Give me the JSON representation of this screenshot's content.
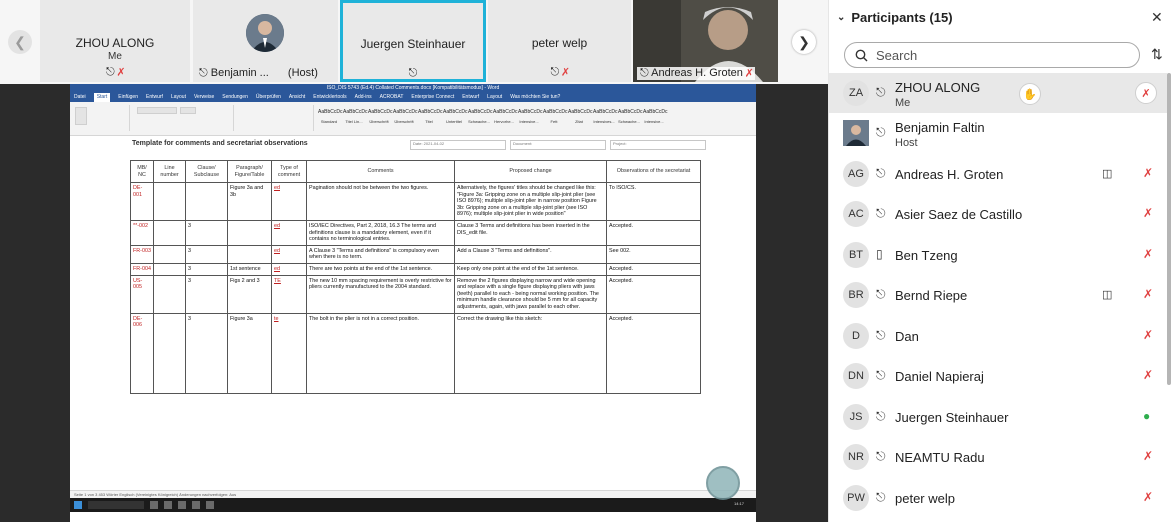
{
  "filmstrip": {
    "tiles": [
      {
        "name": "ZHOU ALONG",
        "sub": "Me"
      },
      {
        "name": "Benjamin ...",
        "sub": "(Host)"
      },
      {
        "name": "Juergen Steinhauer",
        "sub": ""
      },
      {
        "name": "peter welp",
        "sub": ""
      },
      {
        "name": "Andreas H. Groten",
        "sub": ""
      }
    ]
  },
  "word": {
    "title_bar": "ISO_DIS 5743 (Ed.4) Collated Comments.docx [Kompatibilitätsmodus] - Word",
    "tabs": [
      "Datei",
      "Start",
      "Einfügen",
      "Entwurf",
      "Layout",
      "Verweise",
      "Sendungen",
      "Überprüfen",
      "Ansicht",
      "Entwicklertools",
      "Add-ins",
      "ACROBAT",
      "Enterprise Connect",
      "Entwurf",
      "Layout",
      "Was möchten Sie tun?"
    ],
    "styles": [
      "Standard",
      "Titel Lin...",
      "Überschrift",
      "Überschrift",
      "Titel",
      "Untertitel",
      "Schwache...",
      "Hervorhe...",
      "Intensive...",
      "Fett",
      "Zitat",
      "Intensives...",
      "Schwache...",
      "Intensive..."
    ],
    "doc_heading": "Template for comments and secretariat observations",
    "doc_meta": [
      "Date: 2021-04-02",
      "Document:",
      "Project:"
    ],
    "table_headers": [
      "MB/ NC",
      "Line number",
      "Clause/ Subclause",
      "Paragraph/ Figure/Table",
      "Type of comment",
      "Comments",
      "Proposed change",
      "Observations of the secretariat"
    ],
    "rows": [
      {
        "mb": "DE-001",
        "line": "",
        "clause": "",
        "para": "Figure 3a and 3b",
        "type": "ed",
        "comment": "Pagination should not be between the two figures.",
        "change": "Alternatively, the figures' titles should be changed like this: \"Figure 3a: Gripping zone on a multiple slip-joint plier (see ISO 8976); multiple slip-joint plier in narrow position Figure 3b: Gripping zone on a multiple slip-joint plier (see ISO 8976); multiple slip-joint plier in wide position\"",
        "obs": "To ISO/CS."
      },
      {
        "mb": "**-002",
        "line": "",
        "clause": "3",
        "para": "",
        "type": "ed",
        "comment": "ISO/IEC Directives, Part 2, 2018, 16.3 The terms and definitions clause is a mandatory element, even if it contains no terminological entries.",
        "change": "Clause 3 Terms and definitions has been inserted in the DIS_edit file.",
        "obs": "Accepted."
      },
      {
        "mb": "FR-003",
        "line": "",
        "clause": "3",
        "para": "",
        "type": "ed",
        "comment": "A Clause 3 \"Terms and definitions\" is compulsory even when there is no term.",
        "change": "Add a Clause 3 \"Terms and definitions\".",
        "obs": "See 002."
      },
      {
        "mb": "FR-004",
        "line": "",
        "clause": "3",
        "para": "1st sentence",
        "type": "ed",
        "comment": "There are two points at the end of the 1st sentence.",
        "change": "Keep only one point at the end of the 1st sentence.",
        "obs": "Accepted."
      },
      {
        "mb": "US-005",
        "line": "",
        "clause": "3",
        "para": "Figs 2 and 3",
        "type": "TE",
        "comment": "The new 10 mm spacing requirement is overly restrictive for pliers currently manufactured to the 2004 standard.",
        "change": "Remove the 2 figures displaying narrow and wide opening and replace with a single figure displaying pliers with jaws (teeth) parallel to each - being normal working position. The minimum handle clearance should be 5 mm for all capacity adjustments, again, with jaws parallel to each other.",
        "obs": "Accepted."
      },
      {
        "mb": "DE-006",
        "line": "",
        "clause": "3",
        "para": "Figure 3a",
        "type": "te",
        "comment": "The bolt in the plier is not in a correct position.",
        "change": "Correct the drawing like this sketch:",
        "obs": "Accepted."
      }
    ],
    "status_bar": "Seite 1 von 3   453 Wörter   Englisch (Vereinigtes Königreich)   Änderungen nachverfolgen: Aus",
    "clock": "14:17"
  },
  "participants": {
    "title": "Participants (15)",
    "search_placeholder": "Search",
    "list": [
      {
        "initials": "ZA",
        "name": "ZHOU ALONG",
        "role": "Me"
      },
      {
        "initials": "",
        "name": "Benjamin Faltin",
        "role": "Host"
      },
      {
        "initials": "AG",
        "name": "Andreas H. Groten",
        "role": ""
      },
      {
        "initials": "AC",
        "name": "Asier Saez de Castillo",
        "role": ""
      },
      {
        "initials": "BT",
        "name": "Ben Tzeng",
        "role": ""
      },
      {
        "initials": "BR",
        "name": "Bernd Riepe",
        "role": ""
      },
      {
        "initials": "D",
        "name": "Dan",
        "role": ""
      },
      {
        "initials": "DN",
        "name": "Daniel Napieraj",
        "role": ""
      },
      {
        "initials": "JS",
        "name": "Juergen Steinhauer",
        "role": ""
      },
      {
        "initials": "NR",
        "name": "NEAMTU Radu",
        "role": ""
      },
      {
        "initials": "PW",
        "name": "peter welp",
        "role": ""
      }
    ]
  }
}
